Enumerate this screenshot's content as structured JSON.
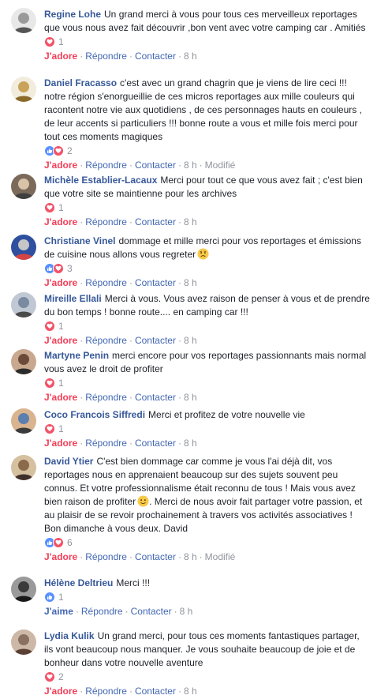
{
  "separator": "·",
  "comments": [
    {
      "author": "Regine Lohe",
      "text": "Un grand merci à vous pour tous ces merveilleux reportages que vous nous avez fait découvrir ,bon vent avec votre camping car . Amitiés",
      "reactions": [
        "heart"
      ],
      "count": "1",
      "love": "J'adore",
      "reply": "Répondre",
      "contact": "Contacter",
      "time": "8 h",
      "edited": ""
    },
    {
      "author": "Daniel Fracasso",
      "text": "c'est avec un grand chagrin que je viens de lire ceci !!! notre région s'enorgueillie de ces micros reportages aux mille couleurs qui racontent notre vie aux quotidiens , de ces personnages hauts en couleurs , de leur accents si particuliers !!! bonne route a vous et mille fois merci pour tout ces moments magiques",
      "reactions": [
        "like",
        "heart"
      ],
      "count": "2",
      "love": "J'adore",
      "reply": "Répondre",
      "contact": "Contacter",
      "time": "8 h",
      "edited": "Modifié"
    },
    {
      "author": "Michèle Establier-Lacaux",
      "text": "Merci pour tout ce que vous avez fait ; c'est bien que votre site se maintienne pour les archives",
      "reactions": [
        "heart"
      ],
      "count": "1",
      "love": "J'adore",
      "reply": "Répondre",
      "contact": "Contacter",
      "time": "8 h",
      "edited": ""
    },
    {
      "author": "Christiane Vinel",
      "text": "dommage et mille merci pour vos reportages et émissions de cuisine nous allons vous regreter",
      "reactions": [
        "like",
        "heart"
      ],
      "count": "3",
      "love": "J'adore",
      "reply": "Répondre",
      "contact": "Contacter",
      "time": "8 h",
      "edited": ""
    },
    {
      "author": "Mireille Ellali",
      "text": "Merci à vous. Vous avez raison de penser à vous et de prendre du bon temps ! bonne route.... en camping car !!!",
      "reactions": [
        "heart"
      ],
      "count": "1",
      "love": "J'adore",
      "reply": "Répondre",
      "contact": "Contacter",
      "time": "8 h",
      "edited": ""
    },
    {
      "author": "Martyne Penin",
      "text": "merci encore pour vos reportages passionnants mais normal vous avez le droit de profiter",
      "reactions": [
        "heart"
      ],
      "count": "1",
      "love": "J'adore",
      "reply": "Répondre",
      "contact": "Contacter",
      "time": "8 h",
      "edited": ""
    },
    {
      "author": "Coco Francois Siffredi",
      "text": "Merci et profitez de votre nouvelle vie",
      "reactions": [
        "heart"
      ],
      "count": "1",
      "love": "J'adore",
      "reply": "Répondre",
      "contact": "Contacter",
      "time": "8 h",
      "edited": ""
    },
    {
      "author": "David Ytier",
      "text": "C'est bien dommage car comme je vous l'ai déjà dit, vos reportages nous en apprenaient beaucoup sur des sujets souvent peu connus. Et votre professionnalisme était reconnu de tous ! Mais vous avez bien raison de profiter",
      "text2": ". Merci de nous avoir fait partager votre passion, et au plaisir de se revoir prochainement à travers vos activités associatives !",
      "text3": "Bon dimanche à vous deux. David",
      "reactions": [
        "like",
        "heart"
      ],
      "count": "6",
      "love": "J'adore",
      "reply": "Répondre",
      "contact": "Contacter",
      "time": "8 h",
      "edited": "Modifié"
    },
    {
      "author": "Hélène Deltrieu",
      "text": "Merci !!!",
      "reactions": [
        "like"
      ],
      "count": "1",
      "love": "J'aime",
      "reply": "Répondre",
      "contact": "Contacter",
      "time": "8 h",
      "edited": ""
    },
    {
      "author": "Lydia Kulik",
      "text": "Un grand merci, pour tous ces moments fantastiques partager, ils vont beaucoup nous manquer. Je vous souhaite beaucoup de joie et de bonheur dans votre nouvelle aventure",
      "reactions": [
        "heart"
      ],
      "count": "2",
      "love": "J'adore",
      "reply": "Répondre",
      "contact": "Contacter",
      "time": "8 h",
      "edited": ""
    }
  ]
}
